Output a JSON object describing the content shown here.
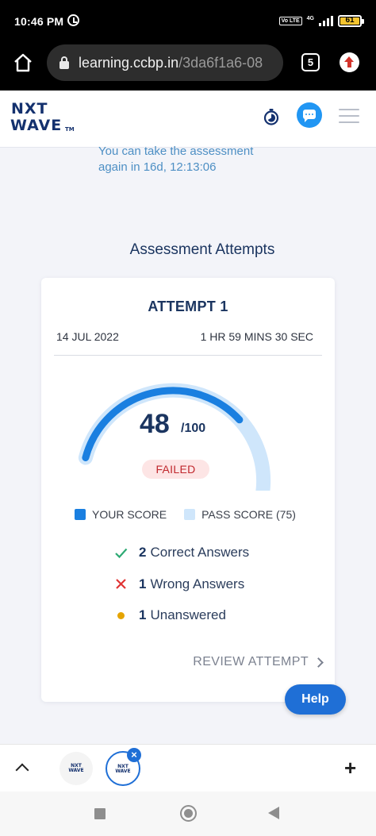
{
  "status_bar": {
    "time": "10:46 PM",
    "volte": "Vo LTE",
    "network": "4G",
    "battery": "61"
  },
  "browser": {
    "url_host": "learning.ccbp.in",
    "url_path": "/3da6f1a6-08",
    "tab_count": "5"
  },
  "header": {
    "logo_line1": "NXT",
    "logo_line2": "WAVE",
    "logo_tm": "TM"
  },
  "retake": {
    "line1": "You can take the assessment",
    "line2": "again in 16d, 12:13:06"
  },
  "section_title": "Assessment Attempts",
  "attempt": {
    "title": "ATTEMPT 1",
    "date": "14 JUL 2022",
    "duration": "1 HR 59 MINS 30 SEC",
    "score": "48",
    "score_total": "/100",
    "score_value": 48,
    "pass_value": 75,
    "max_value": 100,
    "status": "FAILED",
    "legend": {
      "your_score": "YOUR SCORE",
      "pass_score": "PASS SCORE (75)"
    },
    "correct_count": "2",
    "correct_label": "Correct Answers",
    "wrong_count": "1",
    "wrong_label": "Wrong Answers",
    "unanswered_count": "1",
    "unanswered_label": "Unanswered",
    "review_label": "REVIEW ATTEMPT"
  },
  "help_label": "Help",
  "tabstrip": {
    "thumb_line1": "NXT",
    "thumb_line2": "WAVE",
    "close_glyph": "×",
    "new_tab_glyph": "+"
  },
  "colors": {
    "your_score": "#1a7fe0",
    "pass_score": "#cfe6fb",
    "accent": "#1f6fd6",
    "failed_text": "#c0282d",
    "correct": "#2eaa74",
    "wrong": "#e03434",
    "unanswered": "#e5a400"
  }
}
